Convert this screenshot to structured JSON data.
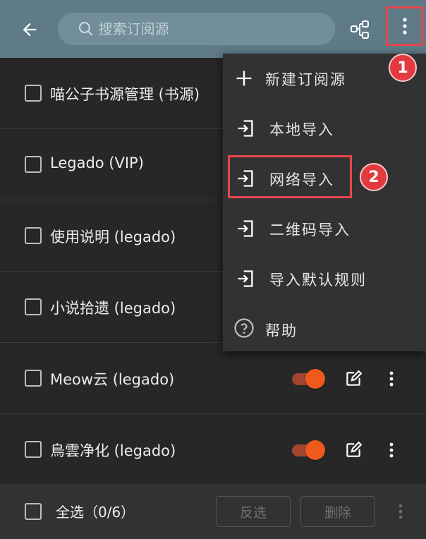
{
  "search": {
    "placeholder": "搜索订阅源"
  },
  "icons": {
    "back": "arrow-left-icon",
    "search": "search-icon",
    "group": "group-icon",
    "more": "more-vert-icon"
  },
  "sources": [
    {
      "name": "喵公子书源管理 (书源)"
    },
    {
      "name": "Legado (VIP)"
    },
    {
      "name": "使用说明 (legado)"
    },
    {
      "name": "小说拾遗 (legado)"
    },
    {
      "name": "Meow云 (legado)",
      "enabled": true
    },
    {
      "name": "烏雲净化 (legado)",
      "enabled": true
    }
  ],
  "menu": {
    "items": [
      {
        "label": "新建订阅源",
        "icon": "add-icon"
      },
      {
        "label": "本地导入",
        "icon": "import-icon"
      },
      {
        "label": "网络导入",
        "icon": "import-icon"
      },
      {
        "label": "二维码导入",
        "icon": "import-icon"
      },
      {
        "label": "导入默认规则",
        "icon": "import-icon"
      },
      {
        "label": "帮助",
        "icon": "help-icon"
      }
    ]
  },
  "bottom": {
    "select_all": "全选（0/6）",
    "invert": "反选",
    "delete": "删除"
  },
  "annotations": [
    {
      "label": "1"
    },
    {
      "label": "2"
    }
  ],
  "colors": {
    "toolbar": "#5f7b87",
    "background": "#272727",
    "accent": "#ee5a1c",
    "highlight": "#e8474c"
  }
}
